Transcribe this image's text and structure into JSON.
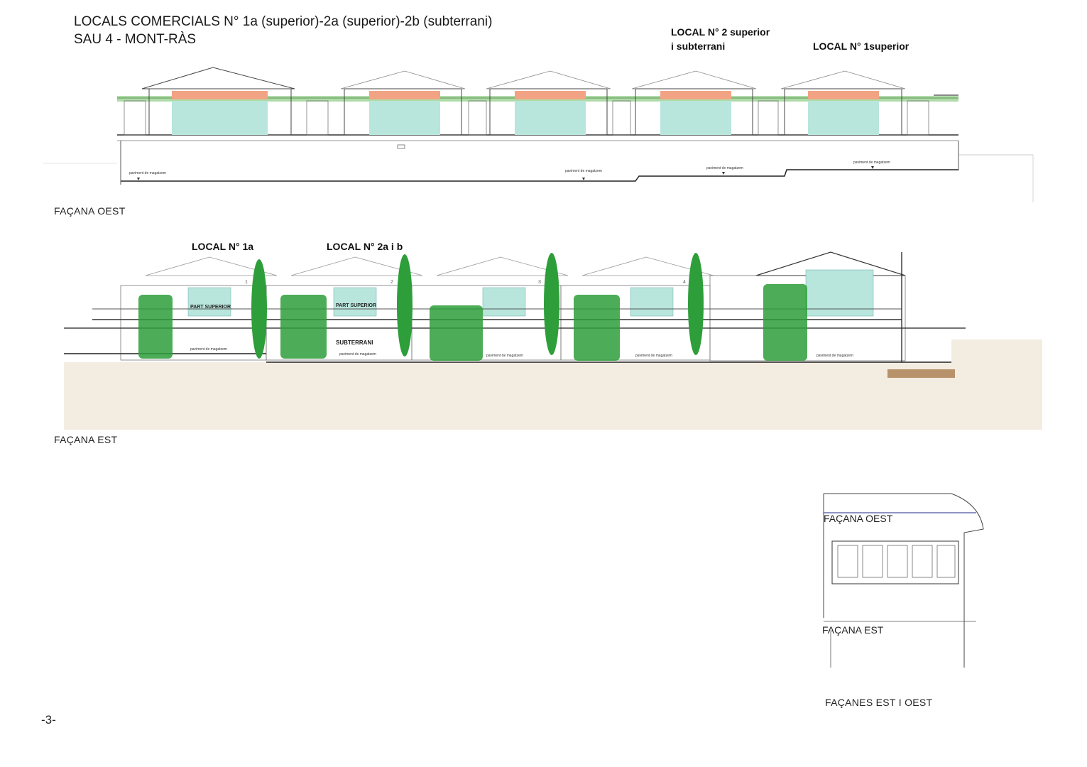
{
  "title": {
    "line1": "LOCALS COMERCIALS N° 1a (superior)-2a (superior)-2b (subterrani)",
    "line2": "SAU 4 - MONT-RÀS"
  },
  "west_facade": {
    "label": "FAÇANA  OEST",
    "callout_local2_line1": "LOCAL N° 2 superior",
    "callout_local2_line2": "i subterrani",
    "callout_local1": "LOCAL N° 1superior",
    "level_notes": [
      "paviment de magatzem",
      "paviment de magatzem",
      "paviment de magatzem",
      "paviment de magatzem"
    ]
  },
  "east_facade": {
    "label": "FAÇANA EST",
    "callout_local1a": "LOCAL N° 1a",
    "callout_local2ab": "LOCAL N° 2a i b",
    "part_superior_1": "PART SUPERIOR",
    "part_superior_2": "PART SUPERIOR",
    "subterrani": "SUBTERRANI",
    "unit_numbers": [
      "1",
      "2",
      "3",
      "4"
    ],
    "level_notes": [
      "paviment de magatzem",
      "paviment de magatzem",
      "paviment de magatzem",
      "paviment de magatzem",
      "paviment de magatzem"
    ]
  },
  "key_plan": {
    "label_west": "FAÇANA OEST",
    "label_east": "FAÇANA EST",
    "caption": "FAÇANES EST I OEST"
  },
  "page_number": "-3-",
  "colors": {
    "glass": "#b8e6dc",
    "fascia": "#f2a384",
    "vegetation": "#2e9e3a",
    "ground": "#f3ece1",
    "line": "#333333"
  }
}
